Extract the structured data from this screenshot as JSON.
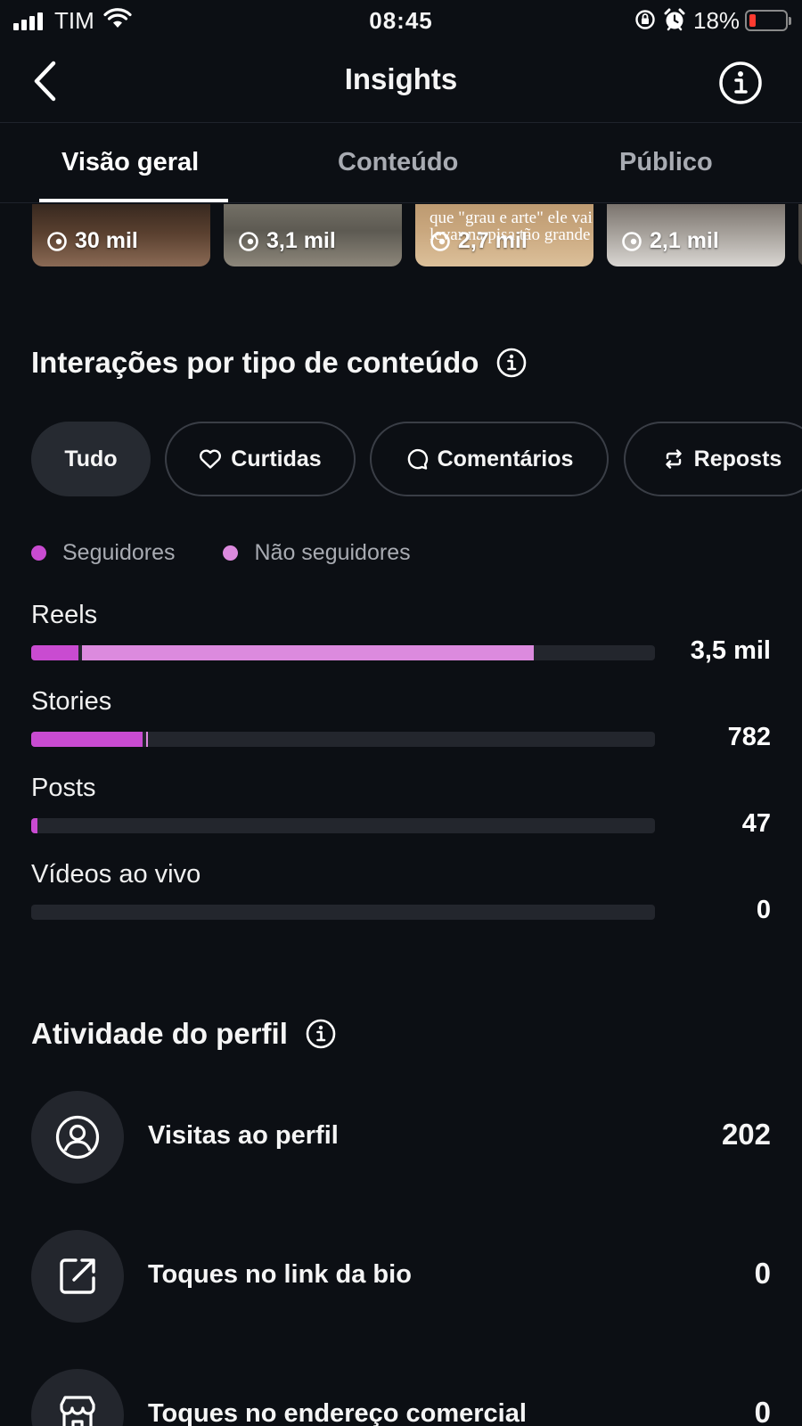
{
  "status_bar": {
    "carrier": "TIM",
    "time": "08:45",
    "battery_percent": "18%",
    "battery_level": 0.18
  },
  "header": {
    "title": "Insights",
    "back_icon": "chevron-left-icon",
    "info_icon": "info-icon"
  },
  "tabs": [
    {
      "label": "Visão geral",
      "active": true
    },
    {
      "label": "Conteúdo",
      "active": false
    },
    {
      "label": "Público",
      "active": false
    }
  ],
  "top_content": [
    {
      "views": "30 mil",
      "caption": ""
    },
    {
      "views": "3,1 mil",
      "caption": ""
    },
    {
      "views": "2,7 mil",
      "caption": "que \"grau e arte\" ele vai levar na pisa tão grande"
    },
    {
      "views": "2,1 mil",
      "caption": ""
    }
  ],
  "interactions": {
    "title": "Interações por tipo de conteúdo",
    "filters": [
      {
        "label": "Tudo",
        "icon": "",
        "active": true
      },
      {
        "label": "Curtidas",
        "icon": "heart-icon",
        "active": false
      },
      {
        "label": "Comentários",
        "icon": "comment-icon",
        "active": false
      },
      {
        "label": "Reposts",
        "icon": "repost-icon",
        "active": false
      }
    ],
    "legend": [
      {
        "label": "Seguidores",
        "color": "#c94bd1"
      },
      {
        "label": "Não seguidores",
        "color": "#dc8ade"
      }
    ],
    "rows": [
      {
        "label": "Reels",
        "value": "3,5 mil",
        "followers_fraction": 0.075,
        "non_followers_fraction": 0.73
      },
      {
        "label": "Stories",
        "value": "782",
        "followers_fraction": 0.178,
        "non_followers_fraction": 0.003
      },
      {
        "label": "Posts",
        "value": "47",
        "followers_fraction": 0.01,
        "non_followers_fraction": 0.0
      },
      {
        "label": "Vídeos ao vivo",
        "value": "0",
        "followers_fraction": 0.0,
        "non_followers_fraction": 0.0
      }
    ]
  },
  "profile_activity": {
    "title": "Atividade do perfil",
    "items": [
      {
        "label": "Visitas ao perfil",
        "value": "202",
        "icon": "profile-icon"
      },
      {
        "label": "Toques no link da bio",
        "value": "0",
        "icon": "external-link-icon"
      },
      {
        "label": "Toques no endereço comercial",
        "value": "0",
        "icon": "store-icon"
      }
    ]
  },
  "colors": {
    "background": "#0c0f14",
    "followers": "#c94bd1",
    "non_followers": "#dc8ade",
    "track": "#23262d"
  }
}
